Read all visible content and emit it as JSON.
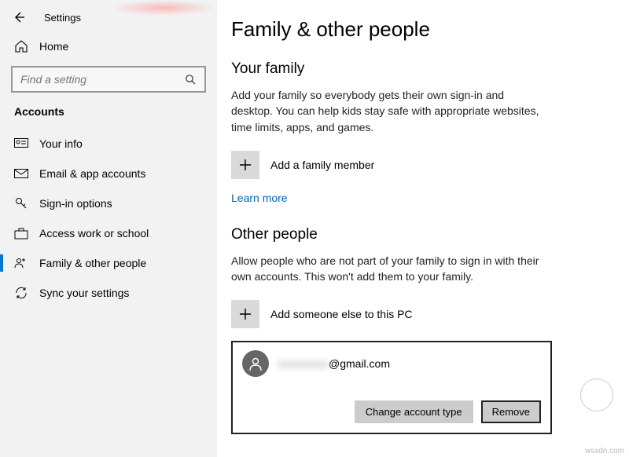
{
  "header": {
    "app_title": "Settings"
  },
  "sidebar": {
    "home_label": "Home",
    "search_placeholder": "Find a setting",
    "section_label": "Accounts",
    "items": [
      {
        "label": "Your info"
      },
      {
        "label": "Email & app accounts"
      },
      {
        "label": "Sign-in options"
      },
      {
        "label": "Access work or school"
      },
      {
        "label": "Family & other people"
      },
      {
        "label": "Sync your settings"
      }
    ]
  },
  "main": {
    "title": "Family & other people",
    "family": {
      "heading": "Your family",
      "description": "Add your family so everybody gets their own sign-in and desktop. You can help kids stay safe with appropriate websites, time limits, apps, and games.",
      "add_label": "Add a family member",
      "learn_more": "Learn more"
    },
    "other": {
      "heading": "Other people",
      "description": "Allow people who are not part of your family to sign in with their own accounts. This won't add them to your family.",
      "add_label": "Add someone else to this PC"
    },
    "account": {
      "name_hidden": "xxxxxxxx",
      "domain": "@gmail.com",
      "change_btn": "Change account type",
      "remove_btn": "Remove"
    }
  },
  "watermark": "wsxdn.com"
}
